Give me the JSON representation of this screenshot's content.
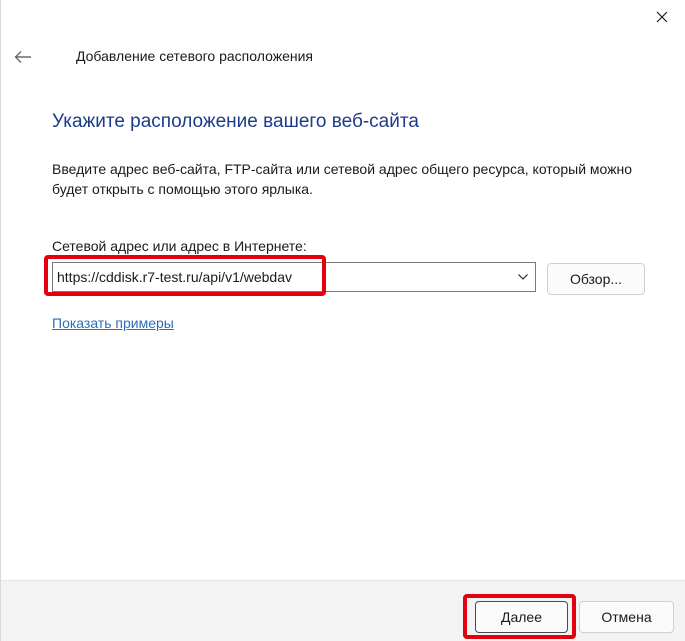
{
  "window": {
    "title": "Добавление сетевого расположения",
    "close_icon": "close-icon",
    "back_icon": "back-arrow-icon"
  },
  "main": {
    "heading": "Укажите расположение вашего веб-сайта",
    "description": "Введите адрес веб-сайта, FTP-сайта или сетевой адрес общего ресурса, который можно будет открыть с помощью этого ярлыка.",
    "field_label": "Сетевой адрес или адрес в Интернете:",
    "address_value": "https://cddisk.r7-test.ru/api/v1/webdav",
    "browse_label": "Обзор...",
    "examples_link": "Показать примеры"
  },
  "footer": {
    "next_label": "Далее",
    "cancel_label": "Отмена"
  },
  "colors": {
    "heading": "#1e3b8a",
    "link": "#2a6ebb",
    "highlight": "#e3000f",
    "footer_bg": "#f3f3f3"
  }
}
